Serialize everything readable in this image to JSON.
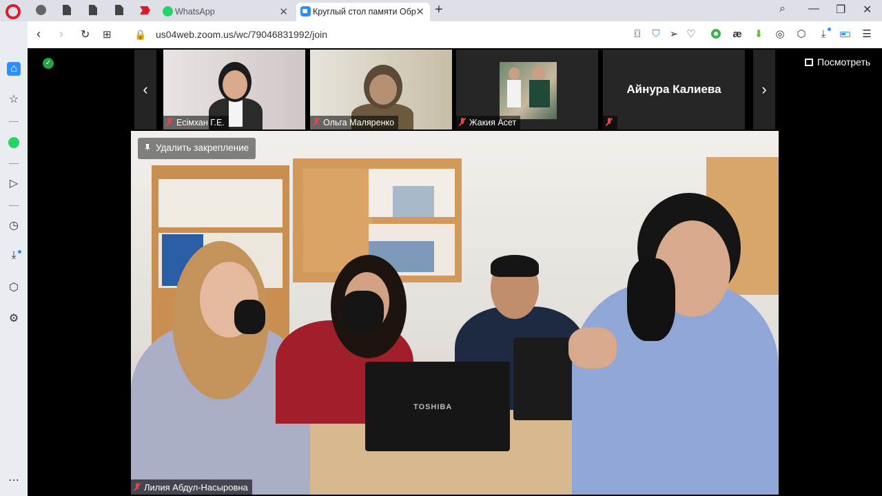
{
  "tabs": [
    {
      "label": "WhatsApp"
    },
    {
      "label": "Круглый стол памяти Обр"
    }
  ],
  "address": {
    "url": "us04web.zoom.us/wc/79046831992/join"
  },
  "zoom": {
    "view_label": "Посмотреть",
    "unpin_label": "Удалить закрепление",
    "participants": [
      {
        "name": "Есімхан Г.Е.",
        "muted": true
      },
      {
        "name": "Ольга Маляренко",
        "muted": true
      },
      {
        "name": "Жакия Асет",
        "muted": true
      },
      {
        "name": "Айнура Калиева",
        "muted": true
      }
    ],
    "active_speaker": {
      "name": "Лилия Абдул-Насыровна",
      "muted": true
    },
    "laptop_brand": "TOSHIBA"
  }
}
